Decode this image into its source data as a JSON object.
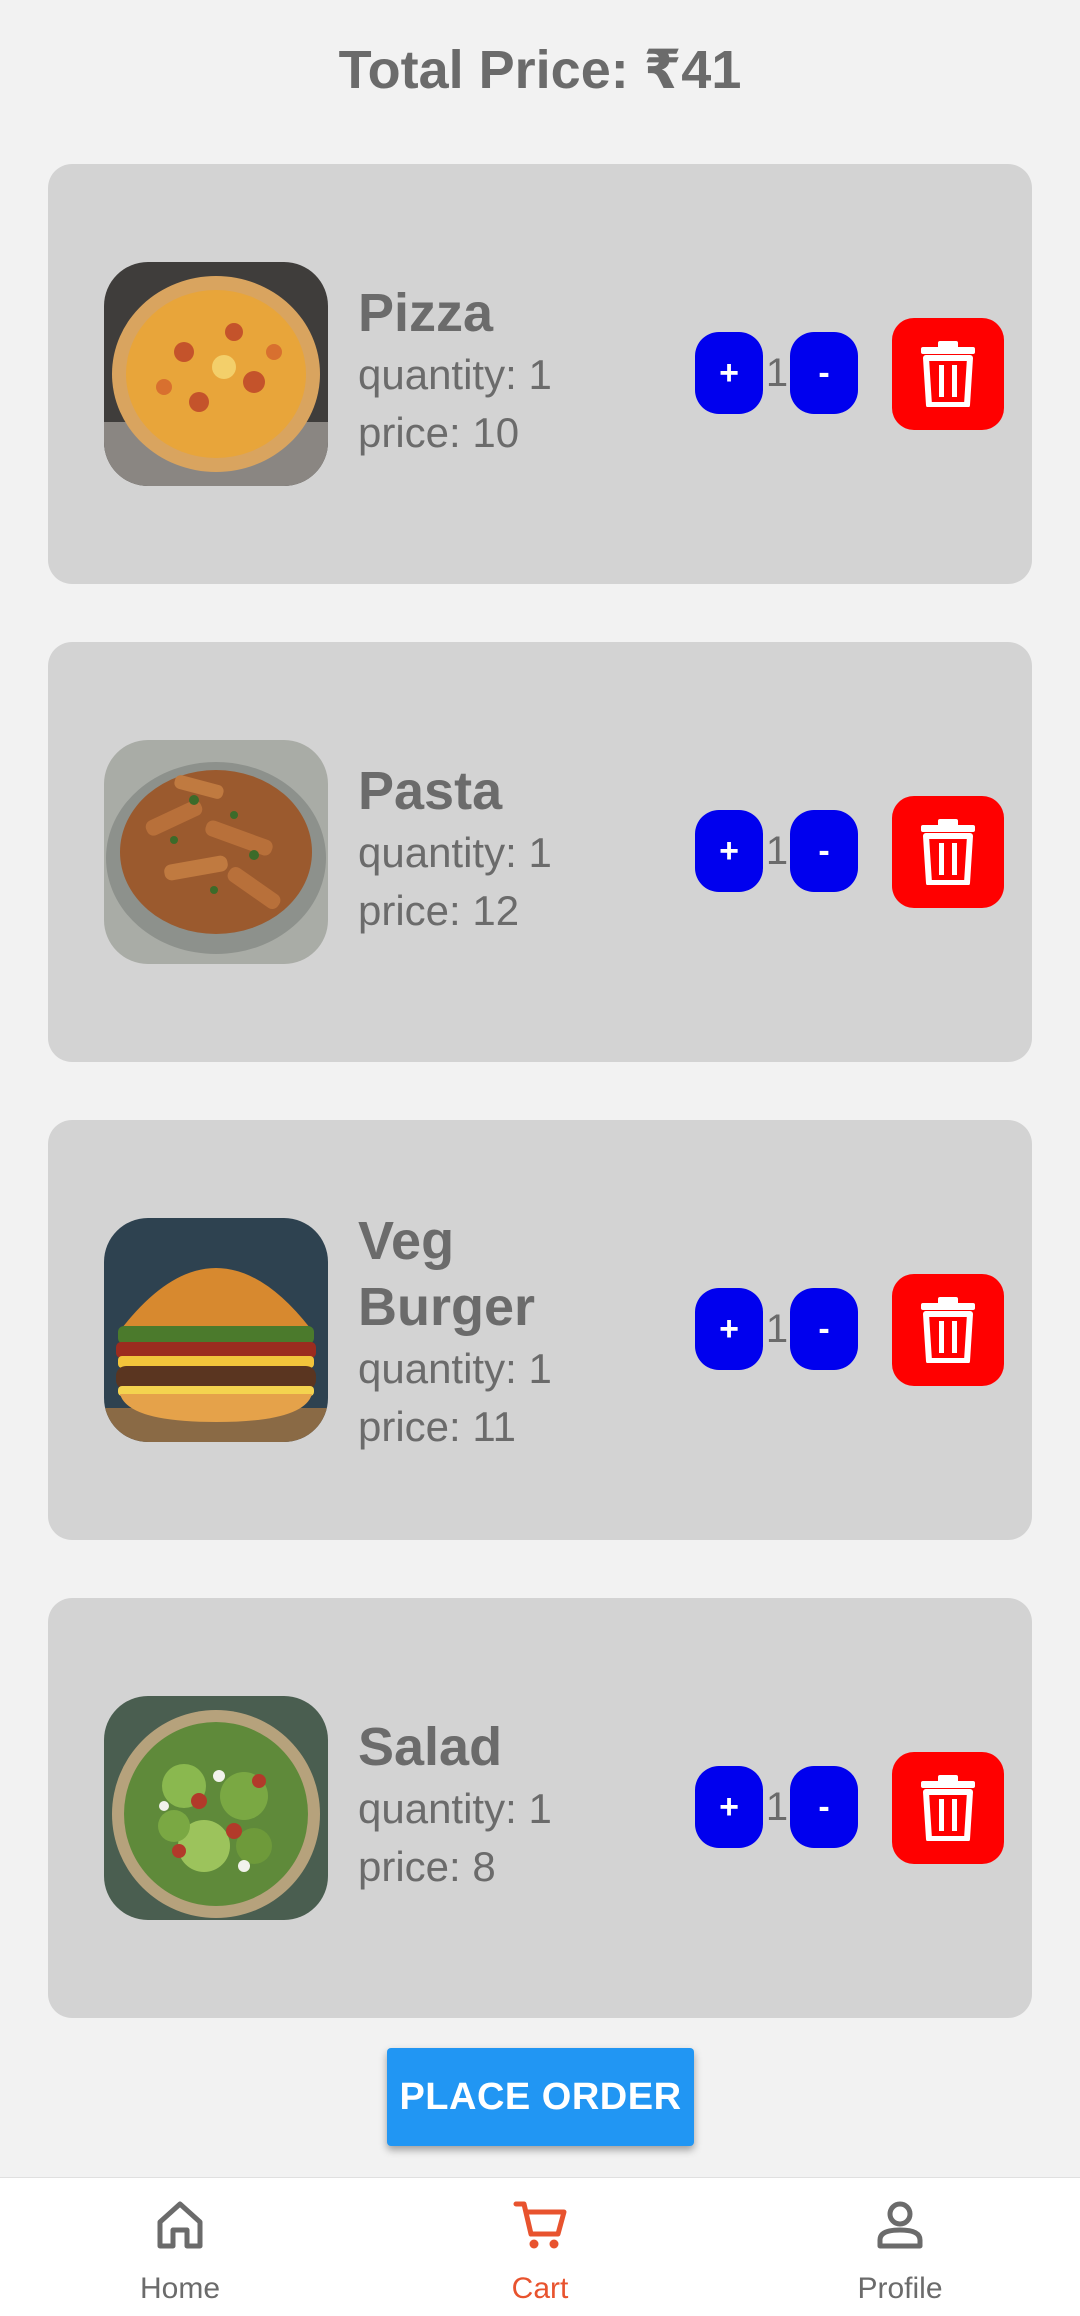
{
  "header": {
    "total_price": "Total Price: ₹41"
  },
  "colors": {
    "background": "#f2f2f2",
    "card": "#d3d3d3",
    "text": "#6b6b6b",
    "stepper_button": "#0000ee",
    "delete_button": "#ff0000",
    "place_order_button": "#2196f3",
    "nav_active": "#e8532e",
    "nav_inactive": "#6b6b6b"
  },
  "cart_items": [
    {
      "name": "Pizza",
      "quantity": "quantity: 1",
      "price": "price: 10",
      "count": "1",
      "plus": "+",
      "minus": "-",
      "image": "pizza-image"
    },
    {
      "name": "Pasta",
      "quantity": "quantity: 1",
      "price": "price: 12",
      "count": "1",
      "plus": "+",
      "minus": "-",
      "image": "pasta-image"
    },
    {
      "name": "Veg Burger",
      "quantity": "quantity: 1",
      "price": "price: 11",
      "count": "1",
      "plus": "+",
      "minus": "-",
      "image": "burger-image"
    },
    {
      "name": "Salad",
      "quantity": "quantity: 1",
      "price": "price: 8",
      "count": "1",
      "plus": "+",
      "minus": "-",
      "image": "salad-image"
    }
  ],
  "actions": {
    "place_order": "PLACE ORDER"
  },
  "bottom_nav": {
    "items": [
      {
        "label": "Home",
        "icon": "home-icon",
        "active": false
      },
      {
        "label": "Cart",
        "icon": "cart-icon",
        "active": true
      },
      {
        "label": "Profile",
        "icon": "profile-icon",
        "active": false
      }
    ]
  }
}
